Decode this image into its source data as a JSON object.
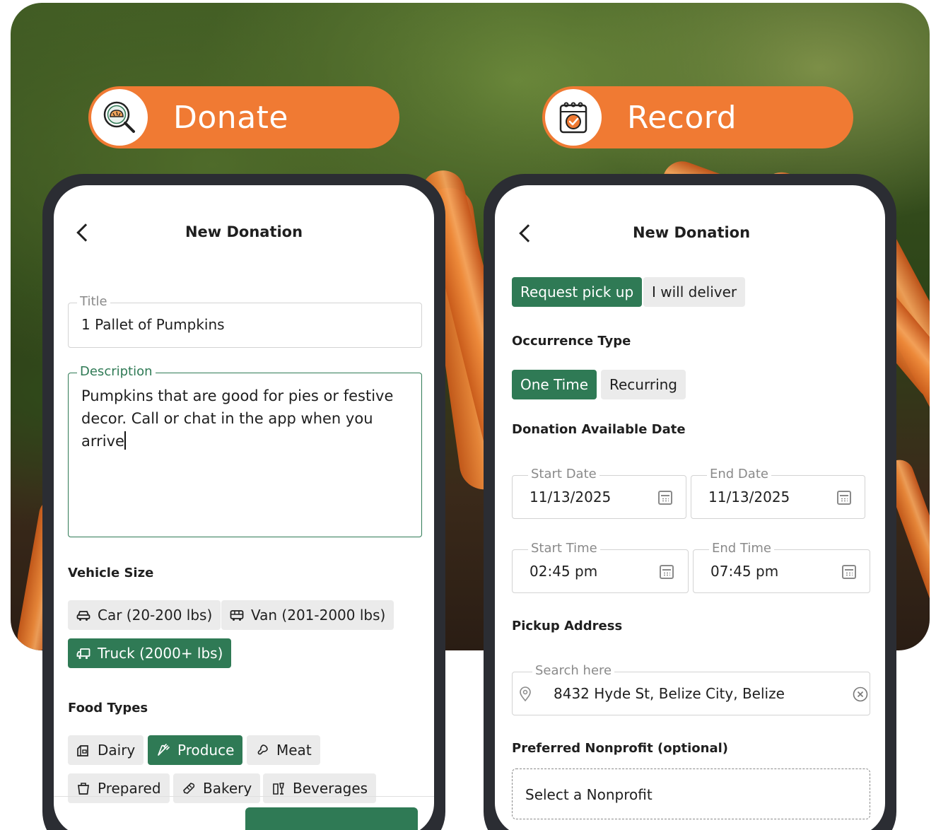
{
  "pills": {
    "donate": {
      "label": "Donate",
      "icon": "magnifier-bread-icon"
    },
    "record": {
      "label": "Record",
      "icon": "calendar-check-icon"
    }
  },
  "colors": {
    "accent_orange": "#f07a33",
    "brand_green": "#2f7a55",
    "chip_gray": "#ebebeb",
    "frame": "#2b2d33"
  },
  "left_screen": {
    "nav_title": "New Donation",
    "title_field": {
      "legend": "Title",
      "value": "1 Pallet of Pumpkins"
    },
    "description_field": {
      "legend": "Description",
      "value": "Pumpkins that are good for pies or festive decor. Call or chat in the app when you arrive"
    },
    "vehicle_size": {
      "label": "Vehicle Size",
      "options": [
        {
          "label": "Car (20-200 lbs)",
          "icon": "car-icon",
          "selected": false
        },
        {
          "label": "Van (201-2000 lbs)",
          "icon": "van-icon",
          "selected": false
        },
        {
          "label": "Truck (2000+ lbs)",
          "icon": "truck-icon",
          "selected": true
        }
      ]
    },
    "food_types": {
      "label": "Food Types",
      "options": [
        {
          "label": "Dairy",
          "icon": "dairy-icon",
          "selected": false
        },
        {
          "label": "Produce",
          "icon": "carrot-icon",
          "selected": true
        },
        {
          "label": "Meat",
          "icon": "meat-icon",
          "selected": false
        },
        {
          "label": "Prepared",
          "icon": "container-icon",
          "selected": false
        },
        {
          "label": "Bakery",
          "icon": "bread-icon",
          "selected": false
        },
        {
          "label": "Beverages",
          "icon": "beverage-icon",
          "selected": false
        }
      ]
    }
  },
  "right_screen": {
    "nav_title": "New Donation",
    "delivery_options": [
      {
        "label": "Request pick up",
        "selected": true
      },
      {
        "label": "I will deliver",
        "selected": false
      }
    ],
    "occurrence": {
      "label": "Occurrence Type",
      "options": [
        {
          "label": "One Time",
          "selected": true
        },
        {
          "label": "Recurring",
          "selected": false
        }
      ]
    },
    "available_date_label": "Donation Available Date",
    "start_date": {
      "legend": "Start Date",
      "value": "11/13/2025"
    },
    "end_date": {
      "legend": "End Date",
      "value": "11/13/2025"
    },
    "start_time": {
      "legend": "Start Time",
      "value": "02:45 pm"
    },
    "end_time": {
      "legend": "End Time",
      "value": "07:45 pm"
    },
    "pickup_address": {
      "label": "Pickup Address",
      "legend": "Search here",
      "value": "8432 Hyde St, Belize City, Belize"
    },
    "preferred_nonprofit": {
      "label": "Preferred Nonprofit (optional)",
      "placeholder": "Select a Nonprofit"
    }
  }
}
